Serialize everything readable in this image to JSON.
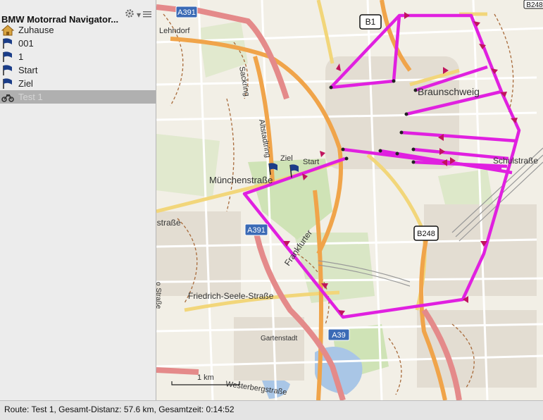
{
  "sidebar": {
    "title": "BMW Motorrad Navigator...",
    "items": [
      {
        "label": "Zuhause",
        "icon": "home-icon"
      },
      {
        "label": "001",
        "icon": "flag-icon"
      },
      {
        "label": "1",
        "icon": "flag-icon"
      },
      {
        "label": "Start",
        "icon": "flag-icon"
      },
      {
        "label": "Ziel",
        "icon": "flag-icon"
      },
      {
        "label": "Test 1",
        "icon": "motorcycle-icon"
      }
    ]
  },
  "map": {
    "labels": {
      "a391_top": "A391",
      "a391_mid": "A391",
      "a39": "A39",
      "b1": "B1",
      "b248": "B248",
      "b248_top": "B248",
      "lehndorf": "Lehndorf",
      "braunschweig": "Braunschweig",
      "muenchenstr": "Münchenstraße",
      "sackring": "Sackring",
      "altstadtring": "Altstadtring",
      "frankfurter": "Frankfurter",
      "friedrich": "Friedrich-Seele-Straße",
      "gartenstadt": "Gartenstadt",
      "westerberg": "Westerbergstraße",
      "nstrasse": "nstraße",
      "schulstrasse": "Schulstraße",
      "ostrasse": "o Straße",
      "ziel_flag": "Ziel",
      "start_flag": "Start",
      "scale": "1 km"
    },
    "route_color": "#e020e0"
  },
  "status": {
    "text": "Route: Test 1, Gesamt-Distanz: 57.6 km, Gesamtzeit: 0:14:52"
  }
}
